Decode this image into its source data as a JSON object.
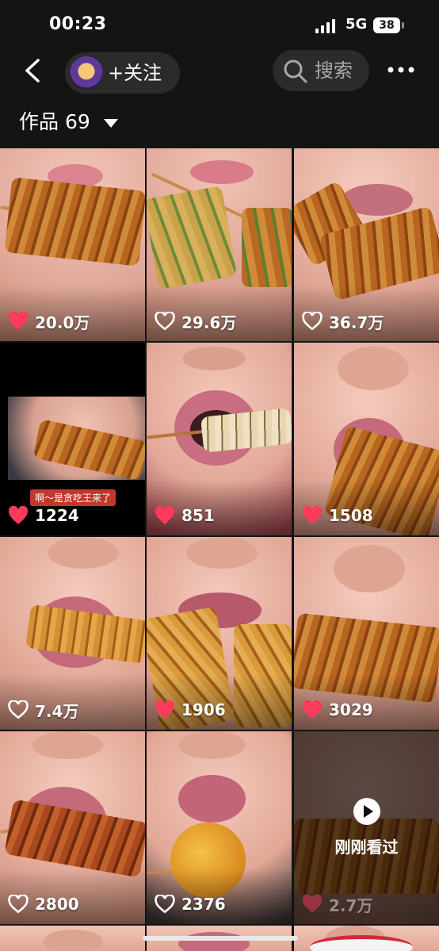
{
  "status_bar": {
    "time": "00:23",
    "network": "5G",
    "battery": "38"
  },
  "header": {
    "follow_label": "+关注",
    "search_placeholder": "搜索"
  },
  "works": {
    "label": "作品 69"
  },
  "colors": {
    "liked_heart": "#ff3b5c",
    "outline_heart": "#ffffff",
    "background": "#141414"
  },
  "videos": [
    {
      "likes": "20.0万",
      "liked": true
    },
    {
      "likes": "29.6万",
      "liked": false
    },
    {
      "likes": "36.7万",
      "liked": false
    },
    {
      "likes": "1224",
      "liked": true,
      "caption": "啊～是贪吃王来了"
    },
    {
      "likes": "851",
      "liked": true
    },
    {
      "likes": "1508",
      "liked": true
    },
    {
      "likes": "7.4万",
      "liked": false
    },
    {
      "likes": "1906",
      "liked": true
    },
    {
      "likes": "3029",
      "liked": true
    },
    {
      "likes": "2800",
      "liked": false
    },
    {
      "likes": "2376",
      "liked": false
    },
    {
      "likes": "2.7万",
      "liked": true,
      "watched_label": "刚刚看过"
    }
  ]
}
